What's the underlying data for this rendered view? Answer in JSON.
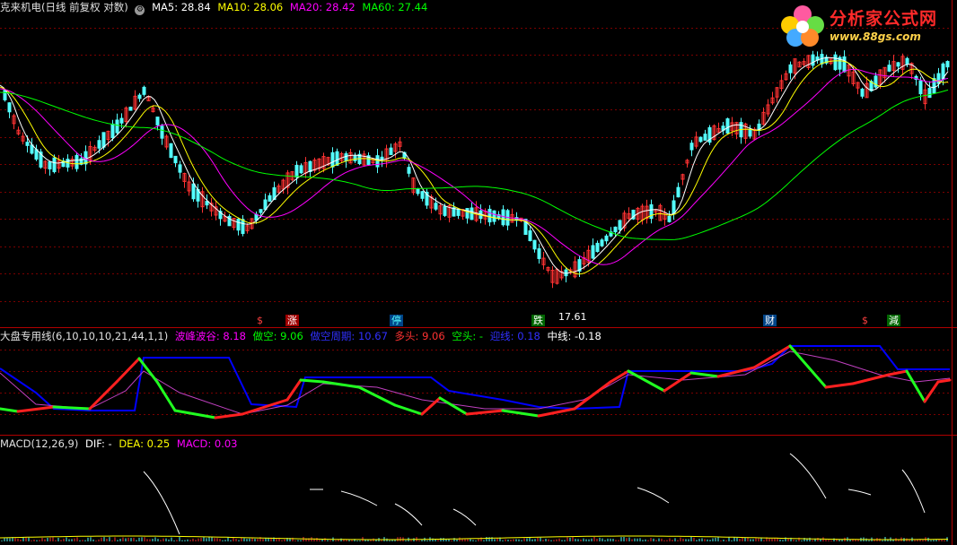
{
  "main_header": {
    "title": "克来机电(日线 前复权 对数)",
    "ma5": "MA5: 28.84",
    "ma10": "MA10: 28.06",
    "ma20": "MA20: 28.42",
    "ma60": "MA60: 27.44"
  },
  "logo": {
    "name": "分析家公式网",
    "url": "www.88gs.com"
  },
  "markers": {
    "zhang": "涨",
    "ting": "停",
    "die": "跌",
    "cai": "财",
    "jian": "減",
    "dollar1": "$",
    "dollar2": "$",
    "low_price": "17.61"
  },
  "indicator_header": {
    "name": "大盘专用线(6,10,10,10,21,44,1,1)",
    "bofeng": "波峰波谷: 8.18",
    "zuokong": "做空: 9.06",
    "zuokong_zhouqi": "做空周期: 10.67",
    "duotou": "多头: 9.06",
    "kongtou": "空头: -",
    "yuxian": "迎线: 0.18",
    "zhongxian": "中线: -0.18"
  },
  "macd_header": {
    "name": "MACD(12,26,9)",
    "dif": "DIF: -",
    "dea": "DEA: 0.25",
    "macd": "MACD: 0.03"
  },
  "colors": {
    "up": "#ff3232",
    "down": "#54ffff",
    "ma5": "#ffffff",
    "ma10": "#ffff00",
    "ma20": "#ff00ff",
    "ma60": "#00ff00",
    "grid": "#7a0000",
    "blue": "#0000ff"
  }
}
